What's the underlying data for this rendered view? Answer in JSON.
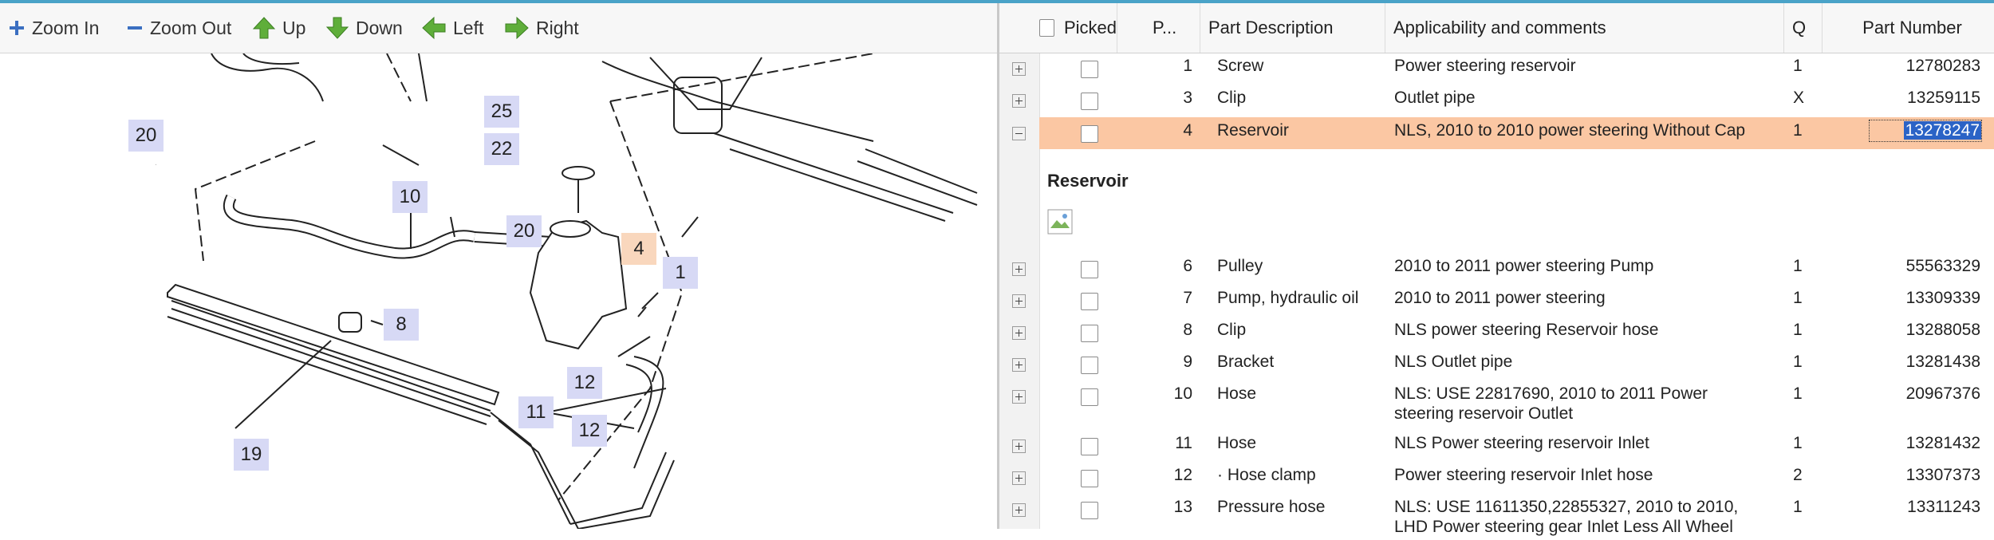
{
  "toolbar": {
    "zoom_in": "Zoom In",
    "zoom_out": "Zoom Out",
    "up": "Up",
    "down": "Down",
    "left": "Left",
    "right": "Right"
  },
  "diagram": {
    "callouts": [
      "20",
      "25",
      "22",
      "10",
      "20",
      "4",
      "1",
      "8",
      "12",
      "11",
      "12",
      "19"
    ]
  },
  "grid": {
    "headers": {
      "picked": "Picked",
      "position": "P...",
      "description": "Part Description",
      "applicability": "Applicability and comments",
      "qty": "Q",
      "part_number": "Part Number"
    },
    "rows": [
      {
        "pos": "1",
        "desc": "Screw",
        "app": "Power steering reservoir",
        "qty": "1",
        "pn": "12780283"
      },
      {
        "pos": "3",
        "desc": "Clip",
        "app": "Outlet pipe",
        "qty": "X",
        "pn": "13259115"
      },
      {
        "pos": "4",
        "desc": "Reservoir",
        "app": "NLS, 2010 to 2010 power steering Without Cap",
        "qty": "1",
        "pn": "13278247"
      },
      {
        "pos": "6",
        "desc": "Pulley",
        "app": "2010 to 2011 power steering Pump",
        "qty": "1",
        "pn": "55563329"
      },
      {
        "pos": "7",
        "desc": "Pump, hydraulic oil",
        "app": "2010 to 2011 power steering",
        "qty": "1",
        "pn": "13309339"
      },
      {
        "pos": "8",
        "desc": "Clip",
        "app": "NLS power steering Reservoir hose",
        "qty": "1",
        "pn": "13288058"
      },
      {
        "pos": "9",
        "desc": "Bracket",
        "app": "NLS Outlet pipe",
        "qty": "1",
        "pn": "13281438"
      },
      {
        "pos": "10",
        "desc": "Hose",
        "app": "NLS: USE 22817690, 2010 to 2011 Power",
        "app2": "steering reservoir Outlet",
        "qty": "1",
        "pn": "20967376"
      },
      {
        "pos": "11",
        "desc": "Hose",
        "app": "NLS Power steering reservoir Inlet",
        "qty": "1",
        "pn": "13281432"
      },
      {
        "pos": "12",
        "desc": "· Hose clamp",
        "app": "Power steering reservoir Inlet hose",
        "qty": "2",
        "pn": "13307373"
      },
      {
        "pos": "13",
        "desc": "Pressure hose",
        "app": "NLS: USE 11611350,22855327, 2010 to 2010,",
        "app2": "LHD Power steering gear Inlet Less All Wheel",
        "qty": "1",
        "pn": "13311243"
      }
    ],
    "detail_title": "Reservoir"
  },
  "colors": {
    "selected_row": "#fbc7a3",
    "selected_pn": "#2b63c6",
    "callout_bg": "#d7d9f5",
    "callout_highlight": "#f9d7bd",
    "arrow_green": "#5fae3a"
  }
}
